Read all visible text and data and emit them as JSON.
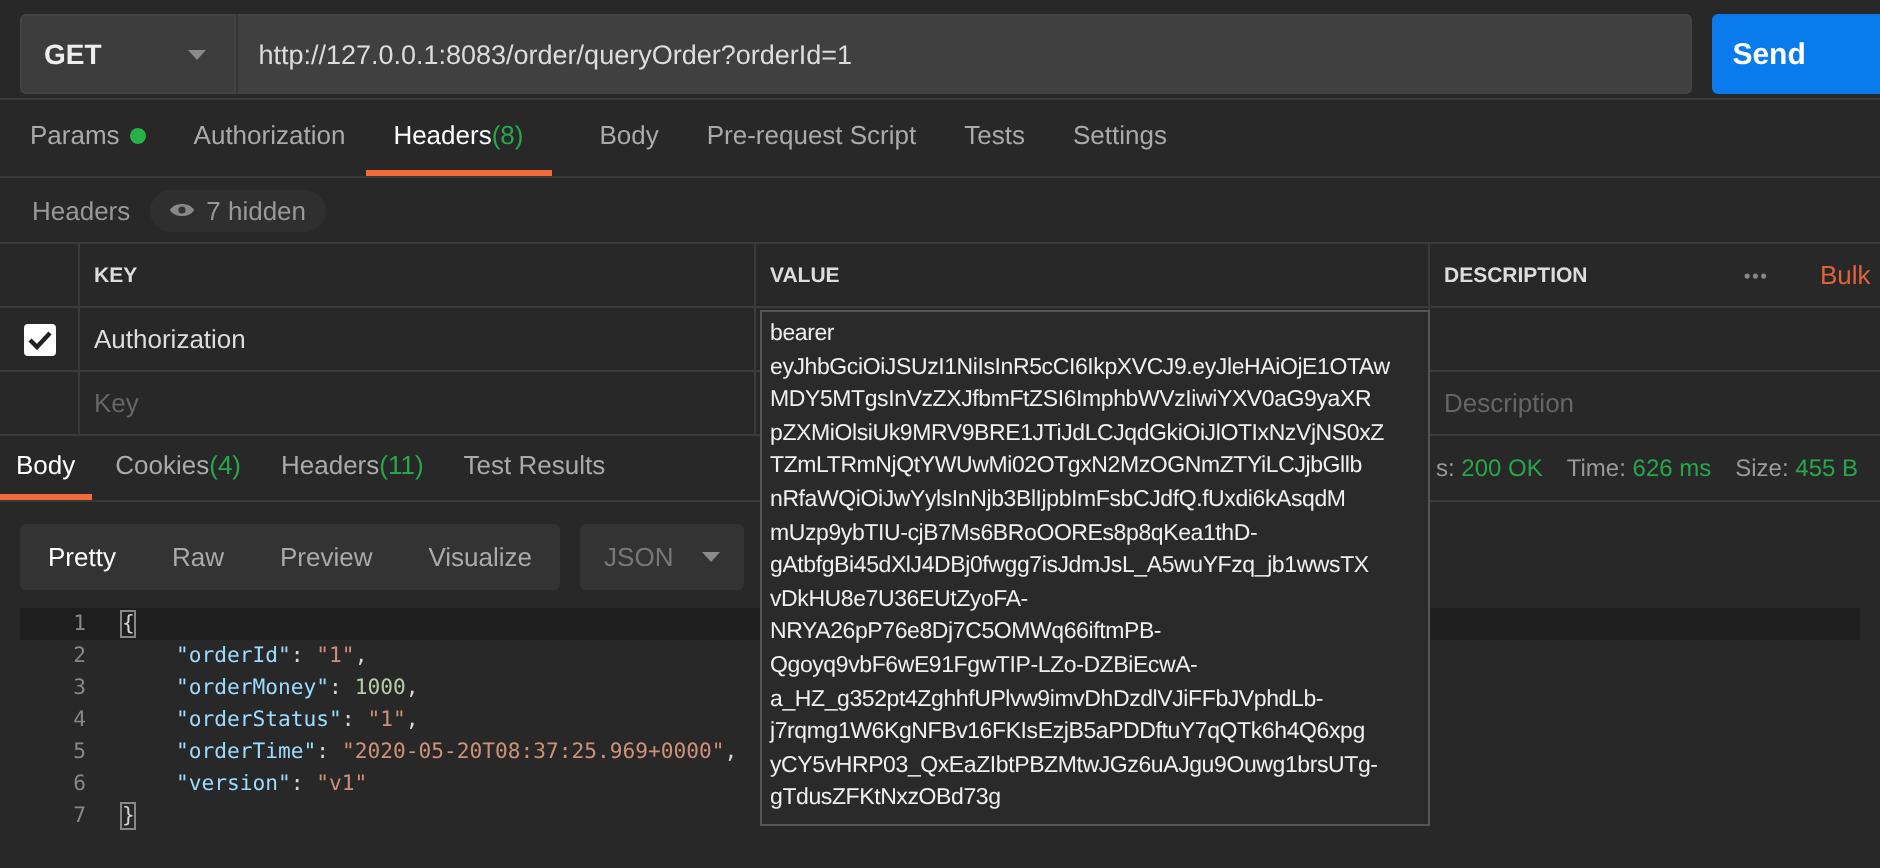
{
  "request": {
    "method": "GET",
    "url": "http://127.0.0.1:8083/order/queryOrder?orderId=1",
    "send": "Send"
  },
  "request_tabs": [
    {
      "label": "Params",
      "dot": true,
      "selected": false
    },
    {
      "label": "Authorization",
      "dot": false,
      "selected": false
    },
    {
      "label": "Headers",
      "count": "(8)",
      "dot": false,
      "selected": true
    },
    {
      "label": "Body",
      "dot": false,
      "selected": false
    },
    {
      "label": "Pre-request Script",
      "dot": false,
      "selected": false
    },
    {
      "label": "Tests",
      "dot": false,
      "selected": false
    },
    {
      "label": "Settings",
      "dot": false,
      "selected": false
    }
  ],
  "headers_bar": {
    "title": "Headers",
    "hidden": "7 hidden"
  },
  "headers_table": {
    "columns": [
      "KEY",
      "VALUE",
      "DESCRIPTION"
    ],
    "more": "•••",
    "bulk": "Bulk",
    "rows": [
      {
        "checked": true,
        "key": "Authorization"
      }
    ],
    "placeholder_row": {
      "key": "Key",
      "description": "Description"
    }
  },
  "value_tooltip": "bearer\neyJhbGciOiJSUzI1NiIsInR5cCI6IkpXVCJ9.eyJleHAiOjE1OTAw\nMDY5MTgsInVzZXJfbmFtZSI6ImphbWVzIiwiYXV0aG9yaXR\npZXMiOlsiUk9MRV9BRE1JTiJdLCJqdGkiOiJlOTIxNzVjNS0xZ\nTZmLTRmNjQtYWUwMi02OTgxN2MzOGNmZTYiLCJjbGllb\nnRfaWQiOiJwYylsInNjb3BlIjpbImFsbCJdfQ.fUxdi6kAsqdM\nmUzp9ybTIU-cjB7Ms6BRoOOREs8p8qKea1thD-\ngAtbfgBi45dXlJ4DBj0fwgg7isJdmJsL_A5wuYFzq_jb1wwsTX\nvDkHU8e7U36EUtZyoFA-\nNRYA26pP76e8Dj7C5OMWq66iftmPB-\nQgoyq9vbF6wE91FgwTIP-LZo-DZBiEcwA-\na_HZ_g352pt4ZghhfUPlvw9imvDhDzdlVJiFFbJVphdLb-\nj7rqmg1W6KgNFBv16FKIsEzjB5aPDDftuY7qQTk6h4Q6xpg\nyCY5vHRP03_QxEaZIbtPBZMtwJGz6uAJgu9Ouwg1brsUTg-\ngTdusZFKtNxzOBd73g",
  "response_tabs": [
    {
      "label": "Body",
      "selected": true
    },
    {
      "label": "Cookies",
      "count": "(4)",
      "selected": false
    },
    {
      "label": "Headers",
      "count": "(11)",
      "selected": false
    },
    {
      "label": "Test Results",
      "selected": false
    }
  ],
  "response_meta": [
    {
      "label": "s:",
      "value": "200 OK"
    },
    {
      "label": "Time:",
      "value": "626 ms"
    },
    {
      "label": "Size:",
      "value": "455 B"
    }
  ],
  "view_modes": [
    {
      "label": "Pretty",
      "selected": true
    },
    {
      "label": "Raw",
      "selected": false
    },
    {
      "label": "Preview",
      "selected": false
    },
    {
      "label": "Visualize",
      "selected": false
    }
  ],
  "format": "JSON",
  "code_lines": [
    {
      "number": "1",
      "tokens": [
        {
          "kind": "bracket",
          "text": "{"
        }
      ]
    },
    {
      "number": "2",
      "tokens": [
        {
          "kind": "key",
          "text": "\"orderId\""
        },
        {
          "kind": "punct",
          "text": ": "
        },
        {
          "kind": "string",
          "text": "\"1\""
        },
        {
          "kind": "punct",
          "text": ","
        }
      ]
    },
    {
      "number": "3",
      "tokens": [
        {
          "kind": "key",
          "text": "\"orderMoney\""
        },
        {
          "kind": "punct",
          "text": ": "
        },
        {
          "kind": "number",
          "text": "1000"
        },
        {
          "kind": "punct",
          "text": ","
        }
      ]
    },
    {
      "number": "4",
      "tokens": [
        {
          "kind": "key",
          "text": "\"orderStatus\""
        },
        {
          "kind": "punct",
          "text": ": "
        },
        {
          "kind": "string",
          "text": "\"1\""
        },
        {
          "kind": "punct",
          "text": ","
        }
      ]
    },
    {
      "number": "5",
      "tokens": [
        {
          "kind": "key",
          "text": "\"orderTime\""
        },
        {
          "kind": "punct",
          "text": ": "
        },
        {
          "kind": "string",
          "text": "\"2020-05-20T08:37:25.969+0000\""
        },
        {
          "kind": "punct",
          "text": ","
        }
      ]
    },
    {
      "number": "6",
      "tokens": [
        {
          "kind": "key",
          "text": "\"version\""
        },
        {
          "kind": "punct",
          "text": ": "
        },
        {
          "kind": "string",
          "text": "\"v1\""
        }
      ]
    },
    {
      "number": "7",
      "tokens": [
        {
          "kind": "bracket",
          "text": "}"
        }
      ]
    }
  ]
}
